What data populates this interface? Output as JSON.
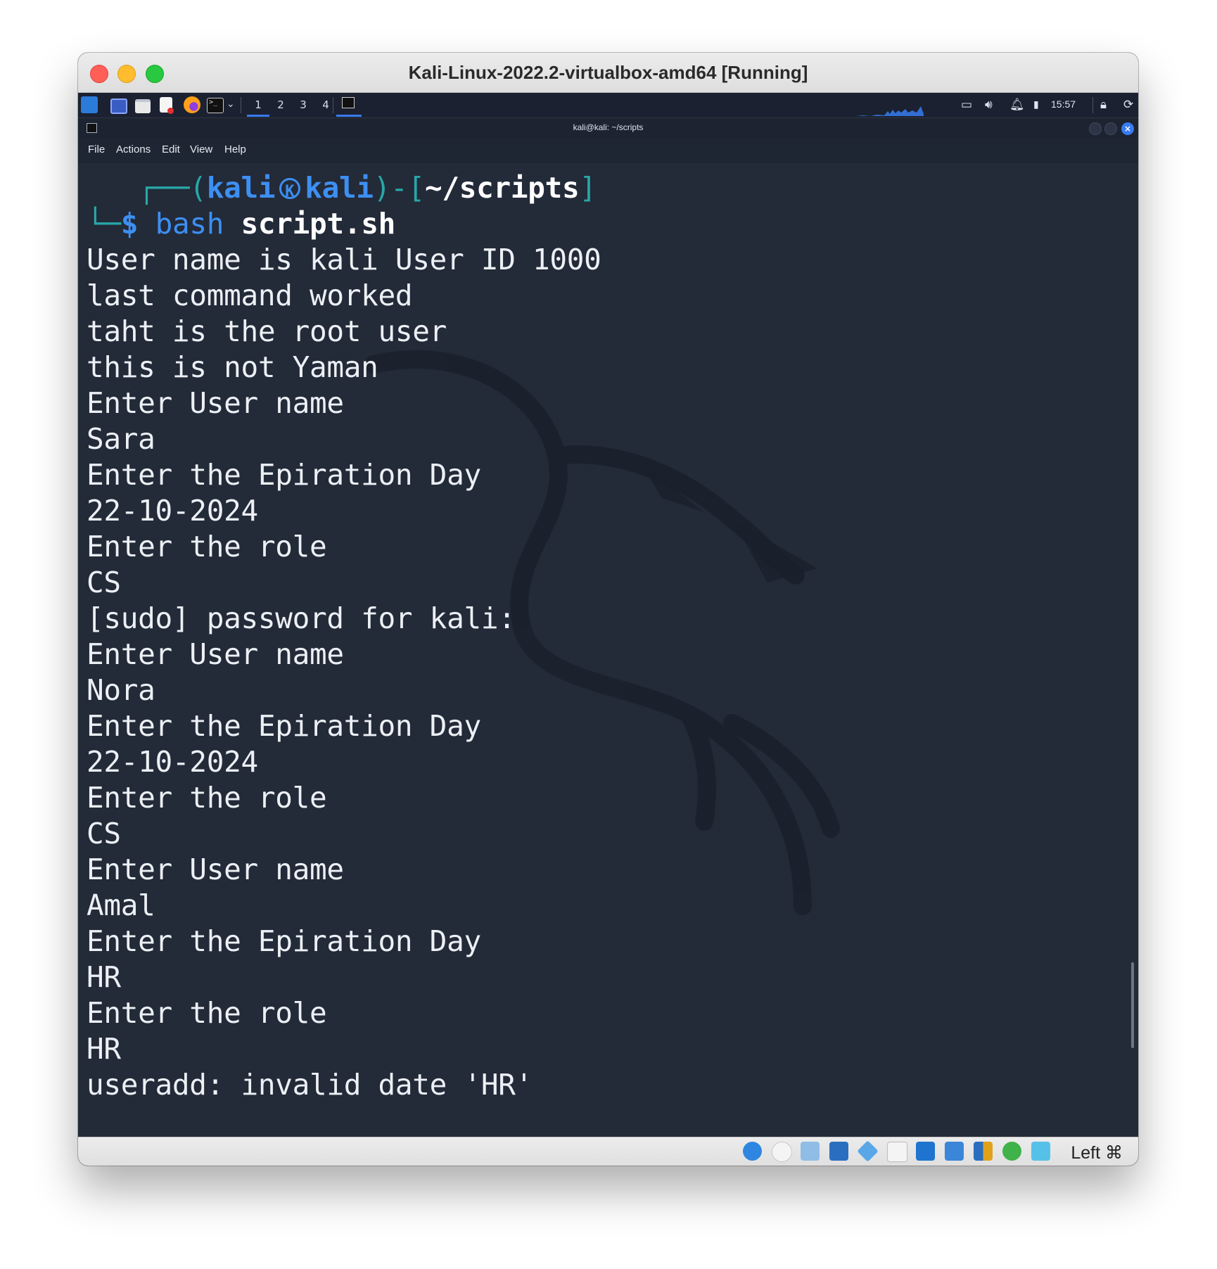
{
  "window": {
    "title": "Kali-Linux-2022.2-virtualbox-amd64 [Running]"
  },
  "panel": {
    "workspaces": [
      "1",
      "2",
      "3",
      "4"
    ],
    "active_workspace": "1",
    "clock": "15:57"
  },
  "terminal": {
    "title": "kali@kali: ~/scripts",
    "menu": [
      "File",
      "Actions",
      "Edit",
      "View",
      "Help"
    ],
    "prompt": {
      "user": "kali",
      "host": "kali",
      "path": "~/scripts",
      "symbol": "$",
      "command_name": "bash",
      "command_arg": "script.sh"
    },
    "output_lines": [
      "User name is kali User ID 1000",
      "last command worked",
      "taht is the root user",
      "this is not Yaman",
      "Enter User name",
      "Sara",
      "Enter the Epiration Day",
      "22-10-2024",
      "Enter the role",
      "CS",
      "[sudo] password for kali:",
      "Enter User name",
      "Nora",
      "Enter the Epiration Day",
      "22-10-2024",
      "Enter the role",
      "CS",
      "Enter User name",
      "Amal",
      "Enter the Epiration Day",
      "HR",
      "Enter the role",
      "HR",
      "useradd: invalid date 'HR'"
    ]
  },
  "statusbar": {
    "host_key": "Left ⌘"
  },
  "colors": {
    "terminal_bg": "#232a38",
    "prompt_green": "#27a7a7",
    "prompt_blue": "#3d8ff2",
    "accent": "#367bf0"
  }
}
